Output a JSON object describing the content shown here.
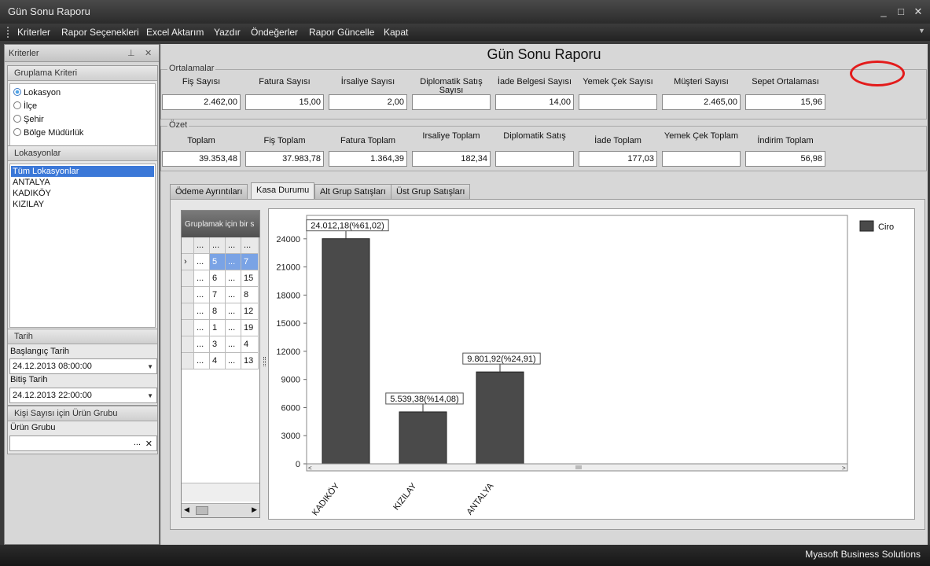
{
  "window": {
    "title": "Gün Sonu Raporu"
  },
  "menu": [
    "Kriterler",
    "Rapor Seçenekleri",
    "Excel Aktarım",
    "Yazdır",
    "Öndeğerler",
    "Rapor Güncelle",
    "Kapat"
  ],
  "left_panel": {
    "title": "Kriterler",
    "grouping": {
      "header": "Gruplama Kriteri",
      "options": [
        "Lokasyon",
        "İlçe",
        "Şehir",
        "Bölge Müdürlük"
      ],
      "selected": "Lokasyon"
    },
    "locations": {
      "header": "Lokasyonlar",
      "items": [
        "Tüm Lokasyonlar",
        "ANTALYA",
        "KADIKÖY",
        "KIZILAY"
      ],
      "selected": "Tüm Lokasyonlar"
    },
    "date": {
      "header": "Tarih",
      "start_label": "Başlangıç Tarih",
      "start_value": "24.12.2013 08:00:00",
      "end_label": "Bitiş Tarih",
      "end_value": "24.12.2013 22:00:00"
    },
    "product_group": {
      "header": "Kişi Sayısı için Ürün Grubu",
      "label": "Ürün Grubu",
      "value": "",
      "ellipsis": "...",
      "clear": "✕"
    }
  },
  "main": {
    "title": "Gün Sonu Raporu",
    "averages": {
      "legend": "Ortalamalar",
      "fields": [
        {
          "label": "Fiş Sayısı",
          "value": "2.462,00"
        },
        {
          "label": "Fatura Sayısı",
          "value": "15,00"
        },
        {
          "label": "İrsaliye Sayısı",
          "value": "2,00"
        },
        {
          "label": "Diplomatik Satış Sayısı",
          "value": ""
        },
        {
          "label": "İade Belgesi Sayısı",
          "value": "14,00"
        },
        {
          "label": "Yemek Çek Sayısı",
          "value": ""
        },
        {
          "label": "Müşteri Sayısı",
          "value": "2.465,00"
        },
        {
          "label": "Sepet Ortalaması",
          "value": "15,96"
        }
      ]
    },
    "summary": {
      "legend": "Özet",
      "fields": [
        {
          "label": "Toplam",
          "value": "39.353,48"
        },
        {
          "label": "Fiş Toplam",
          "value": "37.983,78"
        },
        {
          "label": "Fatura Toplam",
          "value": "1.364,39"
        },
        {
          "label": "Irsaliye Toplam",
          "value": "182,34"
        },
        {
          "label": "Diplomatik Satış",
          "value": ""
        },
        {
          "label": "İade Toplam",
          "value": "177,03"
        },
        {
          "label": "Yemek Çek Toplam",
          "value": ""
        },
        {
          "label": "İndirim Toplam",
          "value": "56,98"
        }
      ]
    },
    "tabs": [
      {
        "label": "Ödeme Ayrıntıları",
        "active": false
      },
      {
        "label": "Kasa Durumu",
        "active": true
      },
      {
        "label": "Alt Grup Satışları",
        "active": false
      },
      {
        "label": "Üst Grup Satışları",
        "active": false
      }
    ],
    "grid": {
      "group_hint": "Gruplamak için bir s",
      "header_cells": [
        "...",
        "...",
        "...",
        "..."
      ],
      "rows": [
        [
          "...",
          "5",
          "...",
          "7"
        ],
        [
          "...",
          "6",
          "...",
          "15"
        ],
        [
          "...",
          "7",
          "...",
          "8"
        ],
        [
          "...",
          "8",
          "...",
          "12"
        ],
        [
          "...",
          "1",
          "...",
          "19"
        ],
        [
          "...",
          "3",
          "...",
          "4"
        ],
        [
          "...",
          "4",
          "...",
          "13"
        ]
      ],
      "current_row_marker": "›"
    }
  },
  "chart_data": {
    "type": "bar",
    "categories": [
      "KADIKÖY",
      "KIZILAY",
      "ANTALYA"
    ],
    "series": [
      {
        "name": "Ciro",
        "values": [
          24012.18,
          5539.38,
          9801.92
        ]
      }
    ],
    "data_labels": [
      "24.012,18(%61,02)",
      "5.539,38(%14,08)",
      "9.801,92(%24,91)"
    ],
    "yticks": [
      0,
      3000,
      6000,
      9000,
      12000,
      15000,
      18000,
      21000,
      24000
    ],
    "ylim": [
      0,
      26500
    ],
    "title": "",
    "xlabel": "",
    "ylabel": "",
    "grid": false,
    "legend": "top-right",
    "bar_color": "#4a4a4a"
  },
  "status": {
    "text": "Myasoft Business Solutions"
  }
}
